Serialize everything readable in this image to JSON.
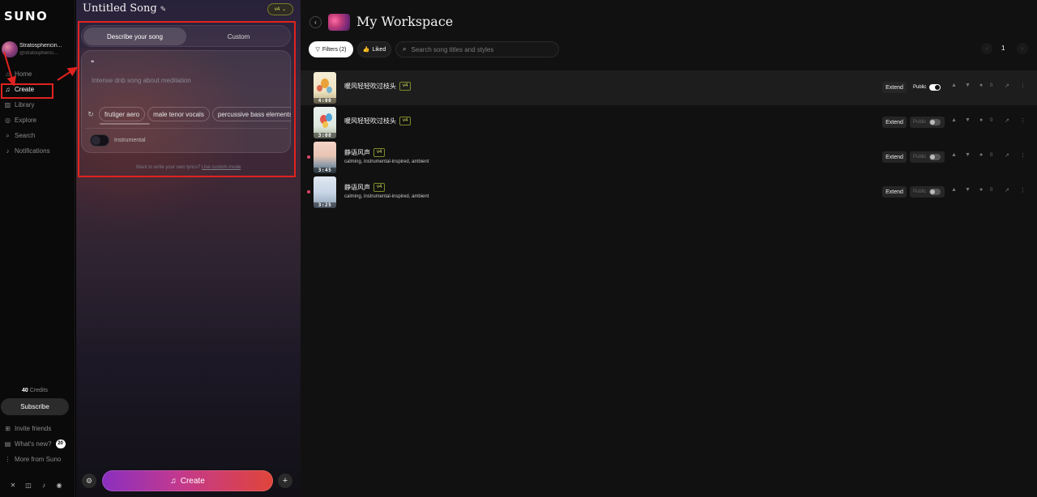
{
  "sidebar": {
    "logo": "SUNO",
    "user": {
      "name": "Stratosphericin...",
      "handle": "@stratospherici..."
    },
    "items": [
      {
        "label": "Home",
        "icon": "home-icon"
      },
      {
        "label": "Create",
        "icon": "music-note-icon"
      },
      {
        "label": "Library",
        "icon": "library-icon"
      },
      {
        "label": "Explore",
        "icon": "compass-icon"
      },
      {
        "label": "Search",
        "icon": "search-icon"
      },
      {
        "label": "Notifications",
        "icon": "bell-icon"
      }
    ],
    "credits_value": "40",
    "credits_label": "Credits",
    "subscribe": "Subscribe",
    "footer": [
      {
        "label": "Invite friends",
        "icon": "gift-icon"
      },
      {
        "label": "What's new?",
        "icon": "news-icon",
        "badge": "20"
      },
      {
        "label": "More from Suno",
        "icon": "more-vertical-icon"
      }
    ],
    "socials": [
      "x-icon",
      "instagram-icon",
      "tiktok-icon",
      "discord-icon"
    ]
  },
  "create_panel": {
    "title": "Untitled Song",
    "version": "v4",
    "tabs": [
      "Describe your song",
      "Custom"
    ],
    "description_placeholder": "Intense dnb song about meditation",
    "chips": [
      "frutiger aero",
      "male tenor vocals",
      "percussive bass elements"
    ],
    "instrumental_label": "Instrumental",
    "lyrics_hint": "Want to write your own lyrics?",
    "lyrics_link": "Use custom mode",
    "create_button": "Create"
  },
  "workspace": {
    "title": "My Workspace",
    "filters_label": "Filters (2)",
    "liked_label": "Liked",
    "search_placeholder": "Search song titles and styles",
    "page": "1",
    "songs": [
      {
        "title": "暖风轻轻吹过枝头",
        "version": "v4",
        "styles": "",
        "duration": "4:00",
        "public": true,
        "likes": "0"
      },
      {
        "title": "暖风轻轻吹过枝头",
        "version": "v4",
        "styles": "",
        "duration": "3:08",
        "public": false,
        "likes": "0"
      },
      {
        "title": "静语风声",
        "version": "v4",
        "styles": "calming, instrumental-inspired, ambient",
        "duration": "3:45",
        "public": false,
        "likes": "0"
      },
      {
        "title": "静语风声",
        "version": "v4",
        "styles": "calming, instrumental-inspired, ambient",
        "duration": "3:25",
        "public": false,
        "likes": "0"
      }
    ],
    "extend_label": "Extend",
    "public_label": "Public"
  },
  "colors": {
    "annotation_red": "#e0231f",
    "version_badge": "#d8e05a",
    "create_gradient": [
      "#8a2fc0",
      "#c2398e",
      "#e0453a"
    ]
  }
}
